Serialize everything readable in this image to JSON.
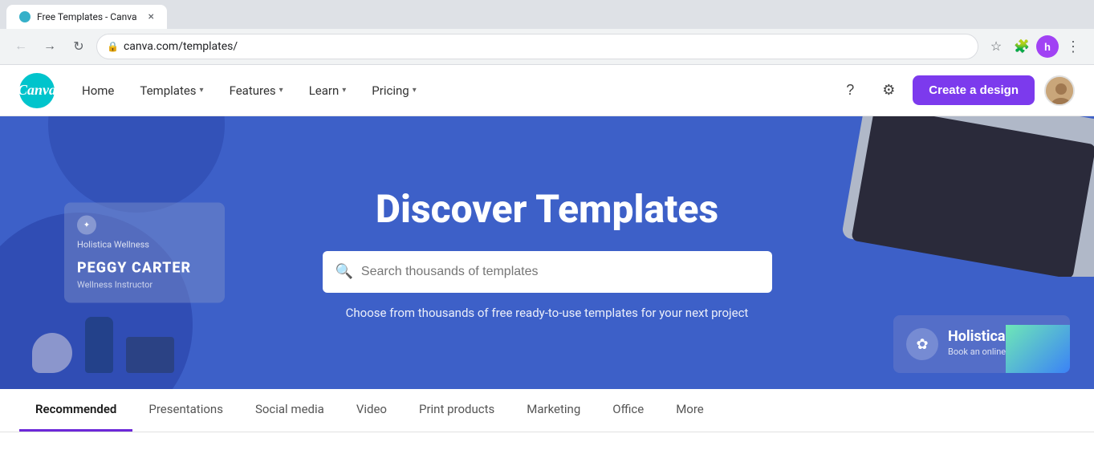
{
  "browser": {
    "tab_title": "Free Templates - Canva",
    "url": "canva.com/templates/",
    "back_btn": "←",
    "forward_btn": "→",
    "reload_btn": "↻",
    "profile_letter": "h"
  },
  "navbar": {
    "logo_text": "Canva",
    "links": [
      {
        "label": "Home",
        "has_chevron": false
      },
      {
        "label": "Templates",
        "has_chevron": true
      },
      {
        "label": "Features",
        "has_chevron": true
      },
      {
        "label": "Learn",
        "has_chevron": true
      },
      {
        "label": "Pricing",
        "has_chevron": true
      }
    ],
    "create_btn": "Create a design",
    "help_icon": "?",
    "settings_icon": "⚙"
  },
  "hero": {
    "title": "Discover Templates",
    "search_placeholder": "Search thousands of templates",
    "subtitle": "Choose from thousands of free ready-to-use templates for your next project",
    "card_left": {
      "brand": "Holistica Wellness",
      "name": "PEGGY CARTER",
      "sub": "Wellness Instructor"
    },
    "card_right": {
      "brand": "Holistica",
      "sub": "Book an online class now"
    }
  },
  "tabs": [
    {
      "label": "Recommended",
      "active": true
    },
    {
      "label": "Presentations",
      "active": false
    },
    {
      "label": "Social media",
      "active": false
    },
    {
      "label": "Video",
      "active": false
    },
    {
      "label": "Print products",
      "active": false
    },
    {
      "label": "Marketing",
      "active": false
    },
    {
      "label": "Office",
      "active": false
    },
    {
      "label": "More",
      "active": false
    }
  ]
}
